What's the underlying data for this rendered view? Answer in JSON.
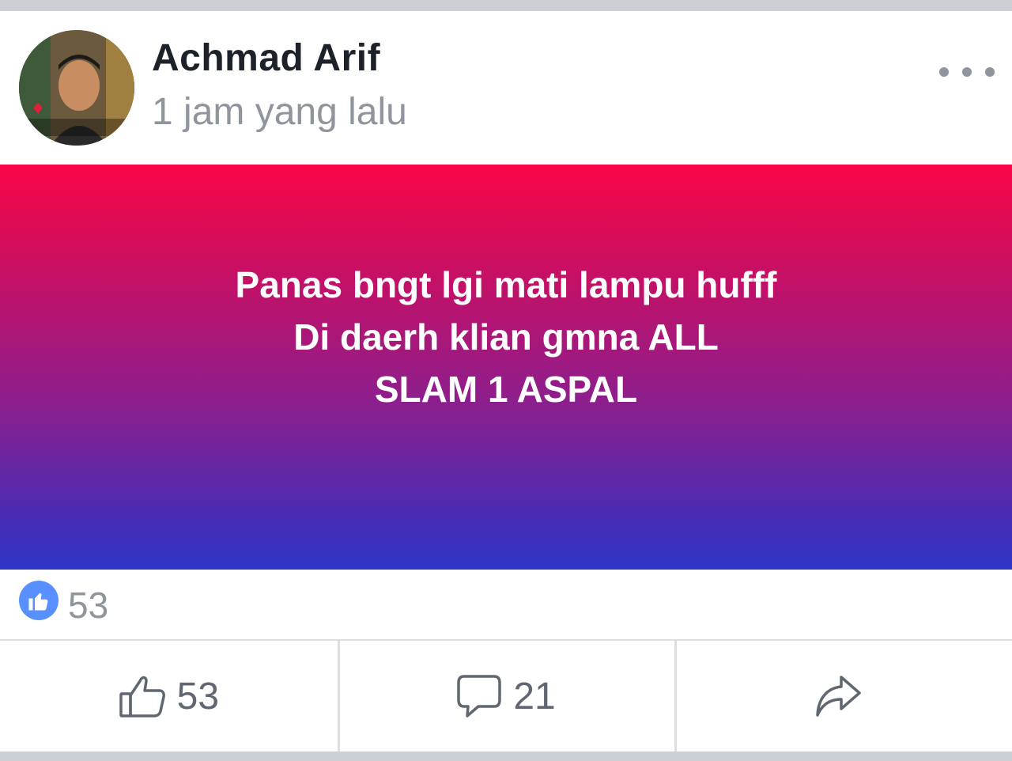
{
  "post": {
    "author": "Achmad Arif",
    "timestamp": "1 jam yang lalu",
    "text_lines": [
      "Panas bngt lgi mati lampu hufff",
      "Di daerh klian gmna ALL",
      "SLAM 1 ASPAL"
    ],
    "background_gradient": [
      "#f90646",
      "#8a1f8f",
      "#2e36c6"
    ],
    "reaction_count": "53"
  },
  "actions": {
    "like_count": "53",
    "comment_count": "21",
    "share_label": ""
  },
  "icons": {
    "more": "more-options-icon",
    "like_badge": "thumbs-up-badge-icon",
    "like": "thumbs-up-icon",
    "comment": "comment-bubble-icon",
    "share": "share-arrow-icon"
  },
  "colors": {
    "like_blue": "#5890ff",
    "text_muted": "#90949c",
    "text_dark": "#1d2129"
  }
}
